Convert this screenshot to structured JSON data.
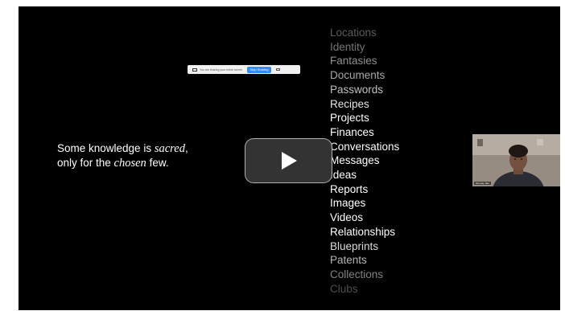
{
  "screen_share_bar": {
    "message": "You are sharing your entire screen",
    "stop_label": "Stop Sharing"
  },
  "tagline": {
    "pre1": "Some knowledge is ",
    "em1": "sacred",
    "post1": ",",
    "pre2": "only for the ",
    "em2": "chosen",
    "post2": " few."
  },
  "word_list": [
    "Locations",
    "Identity",
    "Fantasies",
    "Documents",
    "Passwords",
    "Recipes",
    "Projects",
    "Finances",
    "Conversations",
    "Messages",
    "Ideas",
    "Reports",
    "Images",
    "Videos",
    "Relationships",
    "Blueprints",
    "Patents",
    "Collections",
    "Clubs"
  ],
  "word_opacity": [
    0.35,
    0.45,
    0.55,
    0.65,
    0.75,
    0.9,
    1,
    1,
    1,
    1,
    1,
    1,
    1,
    1,
    1,
    0.85,
    0.7,
    0.5,
    0.3
  ],
  "webcam": {
    "name_label": "Tanmay Jain"
  },
  "icons": {
    "play": "play-icon",
    "share": "screen-share-icon"
  }
}
